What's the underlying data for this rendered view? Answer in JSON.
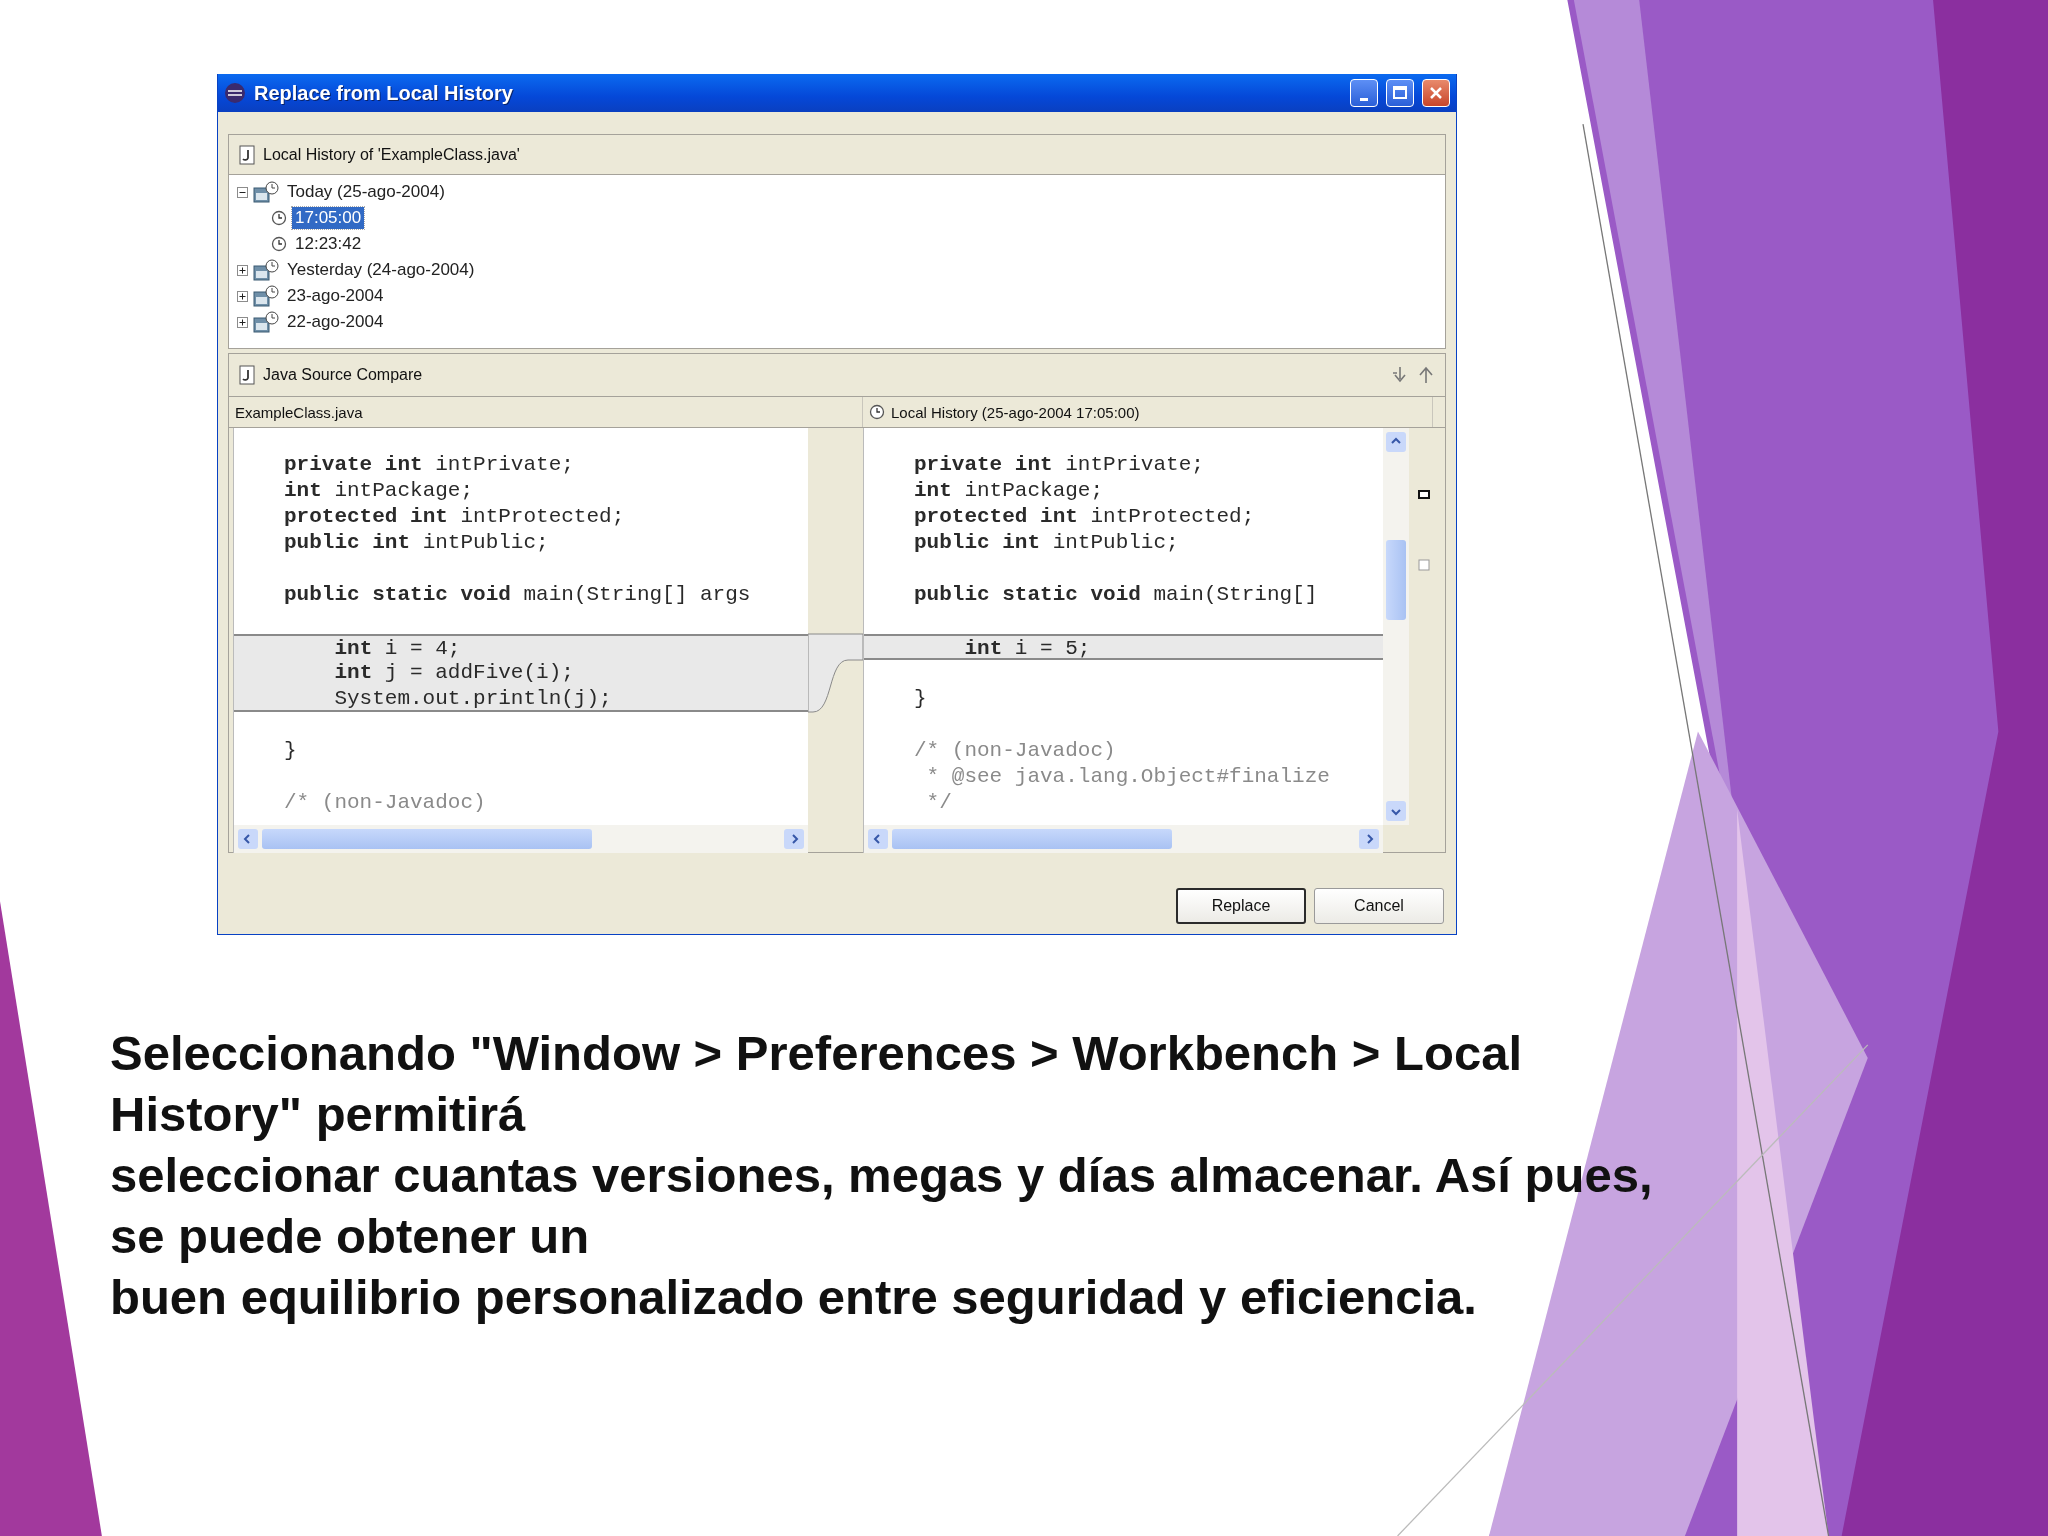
{
  "window": {
    "title": "Replace from Local History"
  },
  "history_tree": {
    "header": "Local History of 'ExampleClass.java'",
    "items": [
      {
        "kind": "day",
        "label": "Today (25-ago-2004)",
        "expanded": true,
        "selected": false,
        "children": [
          {
            "kind": "time",
            "label": "17:05:00",
            "selected": true
          },
          {
            "kind": "time",
            "label": "12:23:42",
            "selected": false
          }
        ]
      },
      {
        "kind": "day",
        "label": "Yesterday (24-ago-2004)",
        "expanded": false,
        "selected": false
      },
      {
        "kind": "day",
        "label": "23-ago-2004",
        "expanded": false,
        "selected": false
      },
      {
        "kind": "day",
        "label": "22-ago-2004",
        "expanded": false,
        "selected": false
      }
    ]
  },
  "compare": {
    "title": "Java Source Compare",
    "left": {
      "header": "ExampleClass.java",
      "lines": [
        {
          "kind": "code",
          "text": "**private** **int** intPrivate;",
          "changed": false
        },
        {
          "kind": "code",
          "text": "**int** intPackage;",
          "changed": false
        },
        {
          "kind": "code",
          "text": "**protected** **int** intProtected;",
          "changed": false
        },
        {
          "kind": "code",
          "text": "**public** **int** intPublic;",
          "changed": false
        },
        {
          "kind": "blank"
        },
        {
          "kind": "code",
          "text": "**public** **static** **void** main(String[] args",
          "changed": false
        },
        {
          "kind": "blank"
        },
        {
          "kind": "code",
          "text": "    **int** i = 4;",
          "changed": true
        },
        {
          "kind": "code",
          "text": "    **int** j = addFive(i);",
          "changed": true
        },
        {
          "kind": "code",
          "text": "    System.out.println(j);",
          "changed": true
        },
        {
          "kind": "blank"
        },
        {
          "kind": "code",
          "text": "}",
          "changed": false
        },
        {
          "kind": "blank"
        },
        {
          "kind": "comment",
          "text": "/* (non-Javadoc)",
          "changed": false
        }
      ]
    },
    "right": {
      "header": "Local History (25-ago-2004 17:05:00)",
      "lines": [
        {
          "kind": "code",
          "text": "**private** **int** intPrivate;",
          "changed": false
        },
        {
          "kind": "code",
          "text": "**int** intPackage;",
          "changed": false
        },
        {
          "kind": "code",
          "text": "**protected** **int** intProtected;",
          "changed": false
        },
        {
          "kind": "code",
          "text": "**public** **int** intPublic;",
          "changed": false
        },
        {
          "kind": "blank"
        },
        {
          "kind": "code",
          "text": "**public** **static** **void** main(String[]",
          "changed": false
        },
        {
          "kind": "blank"
        },
        {
          "kind": "code",
          "text": "    **int** i = 5;",
          "changed": true
        },
        {
          "kind": "blank"
        },
        {
          "kind": "code",
          "text": "}",
          "changed": false
        },
        {
          "kind": "blank"
        },
        {
          "kind": "comment",
          "text": "/* (non-Javadoc)",
          "changed": false
        },
        {
          "kind": "comment",
          "text": " * @see java.lang.Object#finalize",
          "changed": false
        },
        {
          "kind": "comment",
          "text": " */",
          "changed": false
        }
      ]
    }
  },
  "buttons": [
    {
      "label": "Replace",
      "default": true
    },
    {
      "label": "Cancel",
      "default": false
    }
  ],
  "caption": [
    "Seleccionando \"Window > Preferences > Workbench > Local History\" permitirá",
    "seleccionar cuantas versiones, megas y días almacenar. Así pues, se puede obtener un",
    "buen equilibrio personalizado entre seguridad y eficiencia."
  ]
}
